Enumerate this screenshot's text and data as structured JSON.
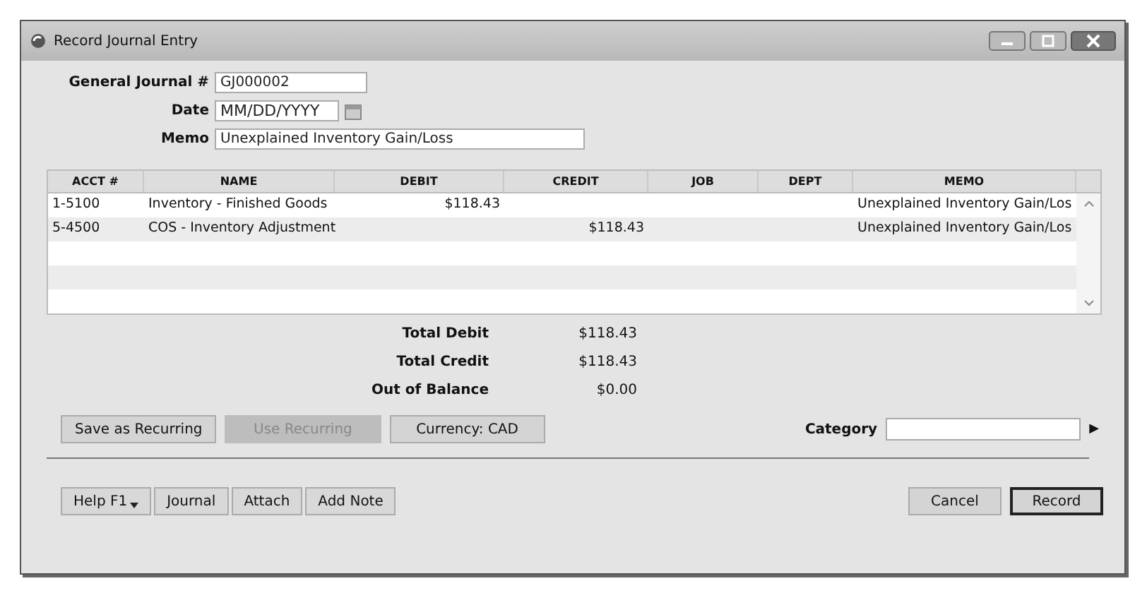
{
  "window": {
    "title": "Record Journal Entry"
  },
  "fields": [
    {
      "label": "General Journal #",
      "value": "GJ000002",
      "kind": "short"
    },
    {
      "label": "Date",
      "value": "MM/DD/YYYY",
      "kind": "date"
    },
    {
      "label": "Memo",
      "value": "Unexplained Inventory Gain/Loss",
      "kind": "long"
    }
  ],
  "table": {
    "columns": [
      "ACCT #",
      "NAME",
      "DEBIT",
      "CREDIT",
      "JOB",
      "DEPT",
      "MEMO"
    ],
    "rows": [
      [
        "1-5100",
        "Inventory - Finished Goods",
        "$118.43",
        "",
        "",
        "",
        "Unexplained Inventory Gain/Los"
      ],
      [
        "5-4500",
        "COS - Inventory Adjustment",
        "",
        "$118.43",
        "",
        "",
        "Unexplained Inventory Gain/Los"
      ]
    ]
  },
  "totals": [
    {
      "label": "Total Debit",
      "value": "$118.43"
    },
    {
      "label": "Total Credit",
      "value": "$118.43"
    },
    {
      "label": "Out of Balance",
      "value": "$0.00"
    }
  ],
  "action_buttons": [
    {
      "label": "Save as Recurring",
      "disabled": false
    },
    {
      "label": "Use Recurring",
      "disabled": true
    },
    {
      "label": "Currency: CAD",
      "disabled": false
    }
  ],
  "category": {
    "label": "Category",
    "arrow": "▶"
  },
  "bottom_left_buttons": [
    {
      "label": "Help F1",
      "kind": "menu"
    },
    {
      "label": "Journal",
      "kind": "plain"
    },
    {
      "label": "Attach",
      "kind": "plain"
    },
    {
      "label": "Add Note",
      "kind": "plain"
    }
  ],
  "bottom_right_buttons": [
    {
      "label": "Cancel",
      "default": false
    },
    {
      "label": "Record",
      "default": true
    }
  ]
}
